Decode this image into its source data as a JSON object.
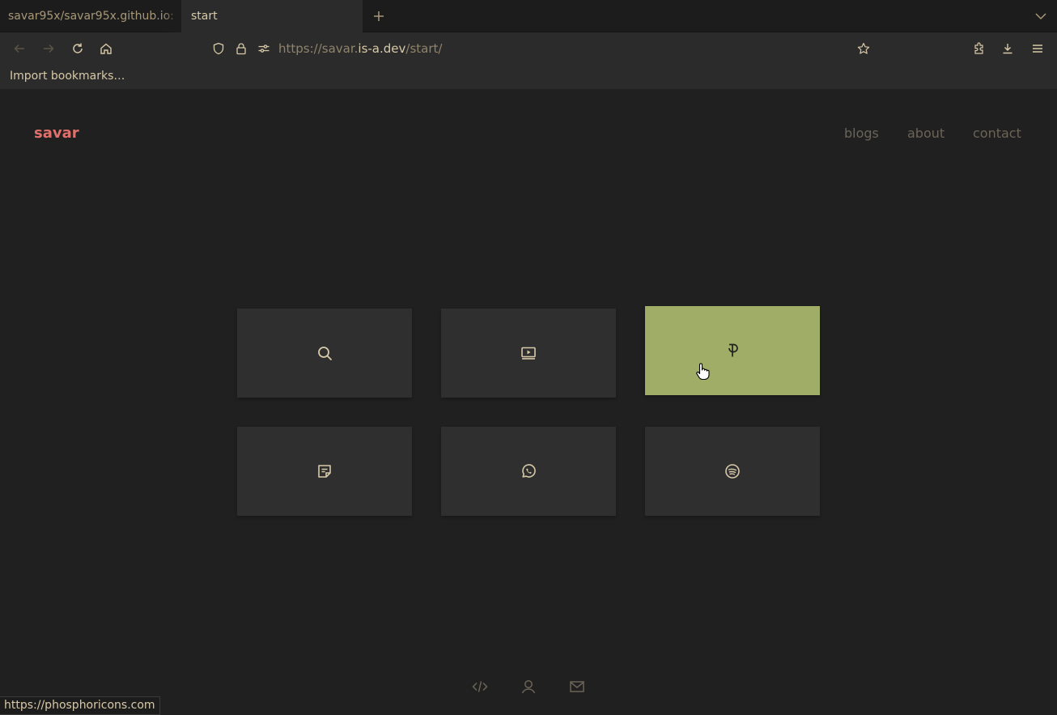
{
  "browser": {
    "tabs": [
      {
        "title": "savar95x/savar95x.github.io:"
      },
      {
        "title": "start"
      }
    ],
    "url": {
      "prefix": "https://savar.",
      "host": "is-a.dev",
      "path": "/start/"
    },
    "bookmarks_bar": {
      "import_label": "Import bookmarks…"
    },
    "status_url": "https://phosphoricons.com",
    "icons": [
      "back-icon",
      "forward-icon",
      "reload-icon",
      "home-icon",
      "shield-icon",
      "lock-icon",
      "permissions-icon",
      "star-icon",
      "extensions-icon",
      "download-icon",
      "menu-icon",
      "plus-icon",
      "chevron-down-icon"
    ]
  },
  "site": {
    "logo": "savar",
    "nav": [
      {
        "label": "blogs"
      },
      {
        "label": "about"
      },
      {
        "label": "contact"
      }
    ],
    "tiles": [
      {
        "icon": "search-icon"
      },
      {
        "icon": "video-icon"
      },
      {
        "icon": "phosphor-logo-icon",
        "state": "hovered"
      },
      {
        "icon": "note-icon"
      },
      {
        "icon": "whatsapp-icon"
      },
      {
        "icon": "spotify-icon"
      }
    ],
    "footer_icons": [
      "code-icon",
      "user-icon",
      "mail-icon"
    ],
    "colors": {
      "background": "#202020",
      "tile": "#2f2f2f",
      "tile_hover": "#a0ad66",
      "logo": "#e0706b",
      "icon": "#d8c9a8",
      "nav_text": "#6b6457"
    }
  }
}
